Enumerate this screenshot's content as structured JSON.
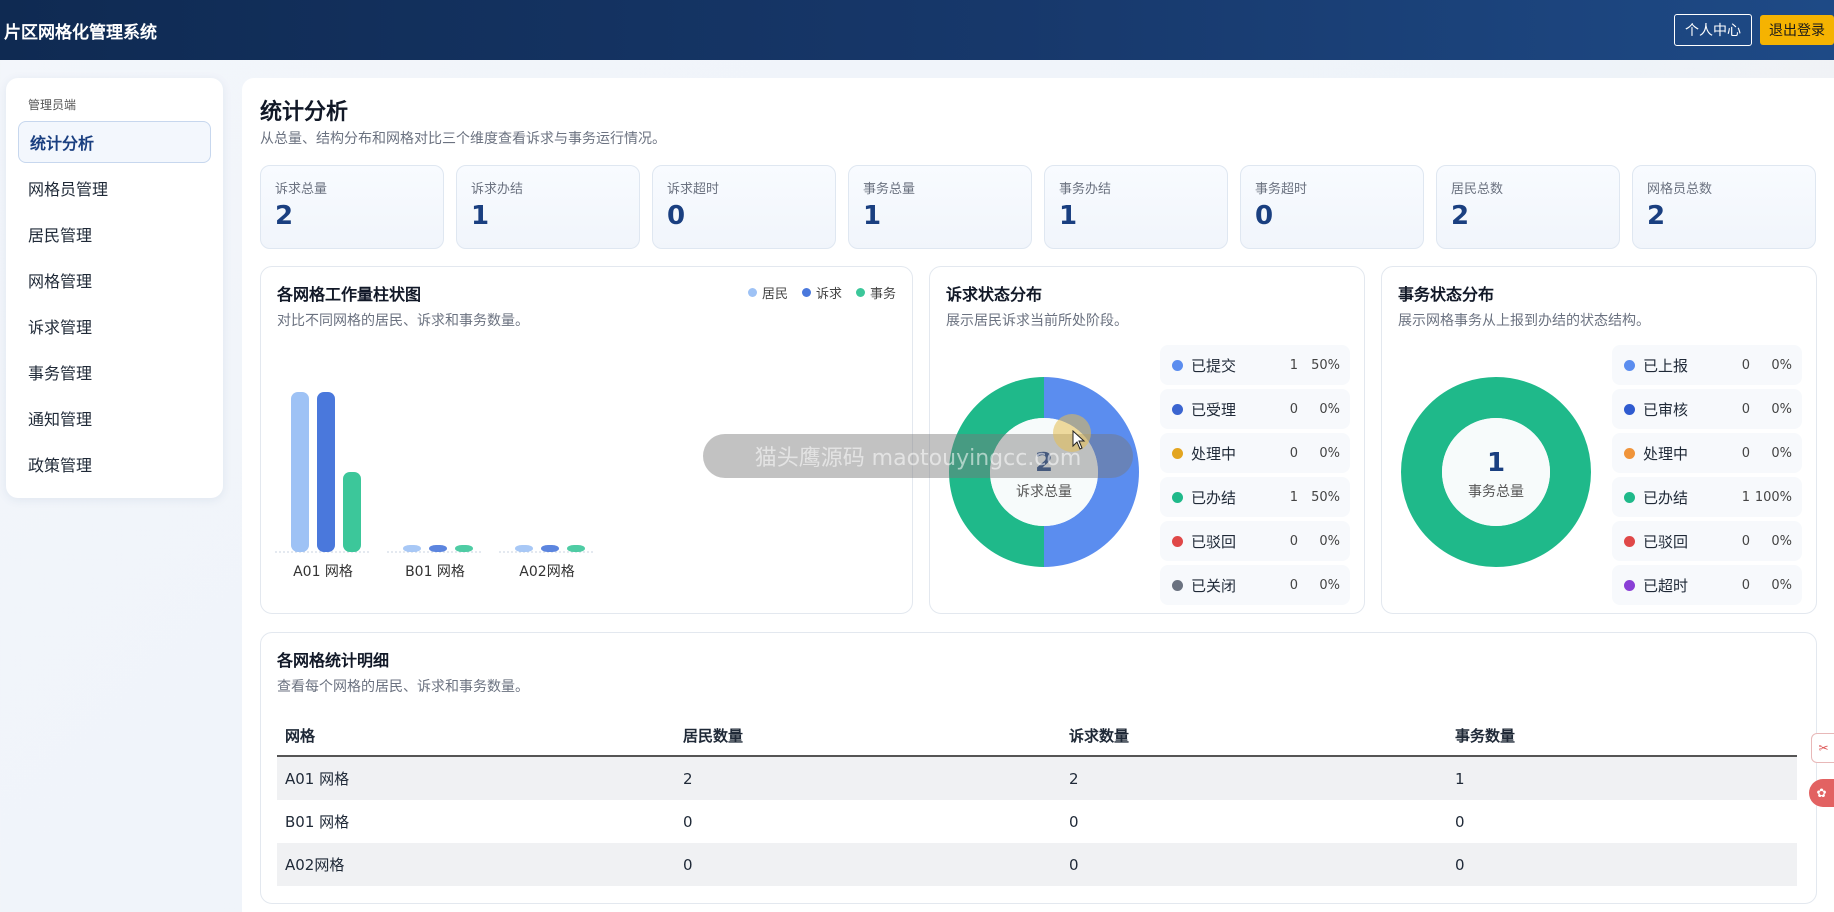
{
  "header": {
    "app_title": "片区网格化管理系统",
    "profile_label": "个人中心",
    "logout_label": "退出登录"
  },
  "sidebar": {
    "role": "管理员端",
    "items": [
      {
        "label": "统计分析",
        "active": true
      },
      {
        "label": "网格员管理"
      },
      {
        "label": "居民管理"
      },
      {
        "label": "网格管理"
      },
      {
        "label": "诉求管理"
      },
      {
        "label": "事务管理"
      },
      {
        "label": "通知管理"
      },
      {
        "label": "政策管理"
      }
    ]
  },
  "page": {
    "title": "统计分析",
    "subtitle": "从总量、结构分布和网格对比三个维度查看诉求与事务运行情况。"
  },
  "stats": [
    {
      "label": "诉求总量",
      "value": "2"
    },
    {
      "label": "诉求办结",
      "value": "1"
    },
    {
      "label": "诉求超时",
      "value": "0"
    },
    {
      "label": "事务总量",
      "value": "1"
    },
    {
      "label": "事务办结",
      "value": "1"
    },
    {
      "label": "事务超时",
      "value": "0"
    },
    {
      "label": "居民总数",
      "value": "2"
    },
    {
      "label": "网格员总数",
      "value": "2"
    }
  ],
  "workload_panel": {
    "title": "各网格工作量柱状图",
    "subtitle": "对比不同网格的居民、诉求和事务数量。"
  },
  "chart_data": {
    "type": "bar",
    "categories": [
      "A01 网格",
      "B01 网格",
      "A02网格"
    ],
    "series": [
      {
        "name": "居民",
        "values": [
          2,
          0,
          0
        ],
        "color": "#9ec2f5"
      },
      {
        "name": "诉求",
        "values": [
          2,
          0,
          0
        ],
        "color": "#4a78dc"
      },
      {
        "name": "事务",
        "values": [
          1,
          0,
          0
        ],
        "color": "#3cc79a"
      }
    ],
    "ylim": [
      0,
      2
    ],
    "legend": "top-right",
    "grid": false
  },
  "appeal_panel": {
    "title": "诉求状态分布",
    "subtitle": "展示居民诉求当前所处阶段。",
    "center_value": "2",
    "center_label": "诉求总量",
    "statuses": [
      {
        "name": "已提交",
        "count": "1",
        "pct": "50%",
        "color": "#5b8def"
      },
      {
        "name": "已受理",
        "count": "0",
        "pct": "0%",
        "color": "#3b65d0"
      },
      {
        "name": "处理中",
        "count": "0",
        "pct": "0%",
        "color": "#e3a520"
      },
      {
        "name": "已办结",
        "count": "1",
        "pct": "50%",
        "color": "#1fb98a"
      },
      {
        "name": "已驳回",
        "count": "0",
        "pct": "0%",
        "color": "#e04848"
      },
      {
        "name": "已关闭",
        "count": "0",
        "pct": "0%",
        "color": "#6b7280"
      }
    ]
  },
  "affairs_panel": {
    "title": "事务状态分布",
    "subtitle": "展示网格事务从上报到办结的状态结构。",
    "center_value": "1",
    "center_label": "事务总量",
    "statuses": [
      {
        "name": "已上报",
        "count": "0",
        "pct": "0%",
        "color": "#5b8def"
      },
      {
        "name": "已审核",
        "count": "0",
        "pct": "0%",
        "color": "#2f5bd0"
      },
      {
        "name": "处理中",
        "count": "0",
        "pct": "0%",
        "color": "#f0943a"
      },
      {
        "name": "已办结",
        "count": "1",
        "pct": "100%",
        "color": "#1fb98a"
      },
      {
        "name": "已驳回",
        "count": "0",
        "pct": "0%",
        "color": "#e04848"
      },
      {
        "name": "已超时",
        "count": "0",
        "pct": "0%",
        "color": "#8a3fd6"
      }
    ]
  },
  "detail_panel": {
    "title": "各网格统计明细",
    "subtitle": "查看每个网格的居民、诉求和事务数量。",
    "columns": [
      "网格",
      "居民数量",
      "诉求数量",
      "事务数量"
    ],
    "rows": [
      [
        "A01 网格",
        "2",
        "2",
        "1"
      ],
      [
        "B01 网格",
        "0",
        "0",
        "0"
      ],
      [
        "A02网格",
        "0",
        "0",
        "0"
      ]
    ]
  },
  "overlay": {
    "watermark": "猫头鹰源码 maotouyingcc.com"
  }
}
